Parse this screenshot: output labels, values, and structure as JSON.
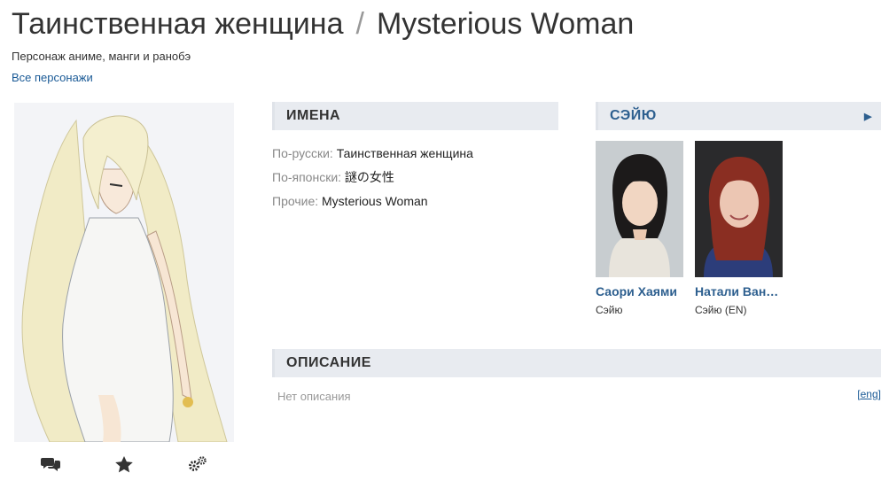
{
  "header": {
    "title_ru": "Таинственная женщина",
    "separator": "/",
    "title_en": "Mysterious Woman",
    "subtitle": "Персонаж аниме, манги и ранобэ",
    "all_characters_link": "Все персонажи"
  },
  "names_section": {
    "heading": "ИМЕНА",
    "rows": [
      {
        "label": "По-русски:",
        "value": "Таинственная женщина"
      },
      {
        "label": "По-японски:",
        "value": "謎の女性"
      },
      {
        "label": "Прочие:",
        "value": "Mysterious Woman"
      }
    ]
  },
  "seyu_section": {
    "heading": "СЭЙЮ",
    "expand_icon": "triangle-right-icon",
    "actors": [
      {
        "name": "Саори Хаями",
        "role": "Сэйю"
      },
      {
        "name": "Натали Ван…",
        "role": "Сэйю (EN)"
      }
    ]
  },
  "description_section": {
    "heading": "ОПИСАНИЕ",
    "empty_text": "Нет описания",
    "lang_link": "[eng]"
  },
  "actions": {
    "icons": [
      "comments-icon",
      "star-icon",
      "gears-icon"
    ]
  },
  "colors": {
    "link": "#1a5a96",
    "accent": "#2d5f8f",
    "section_bg": "#e8ebf0"
  }
}
